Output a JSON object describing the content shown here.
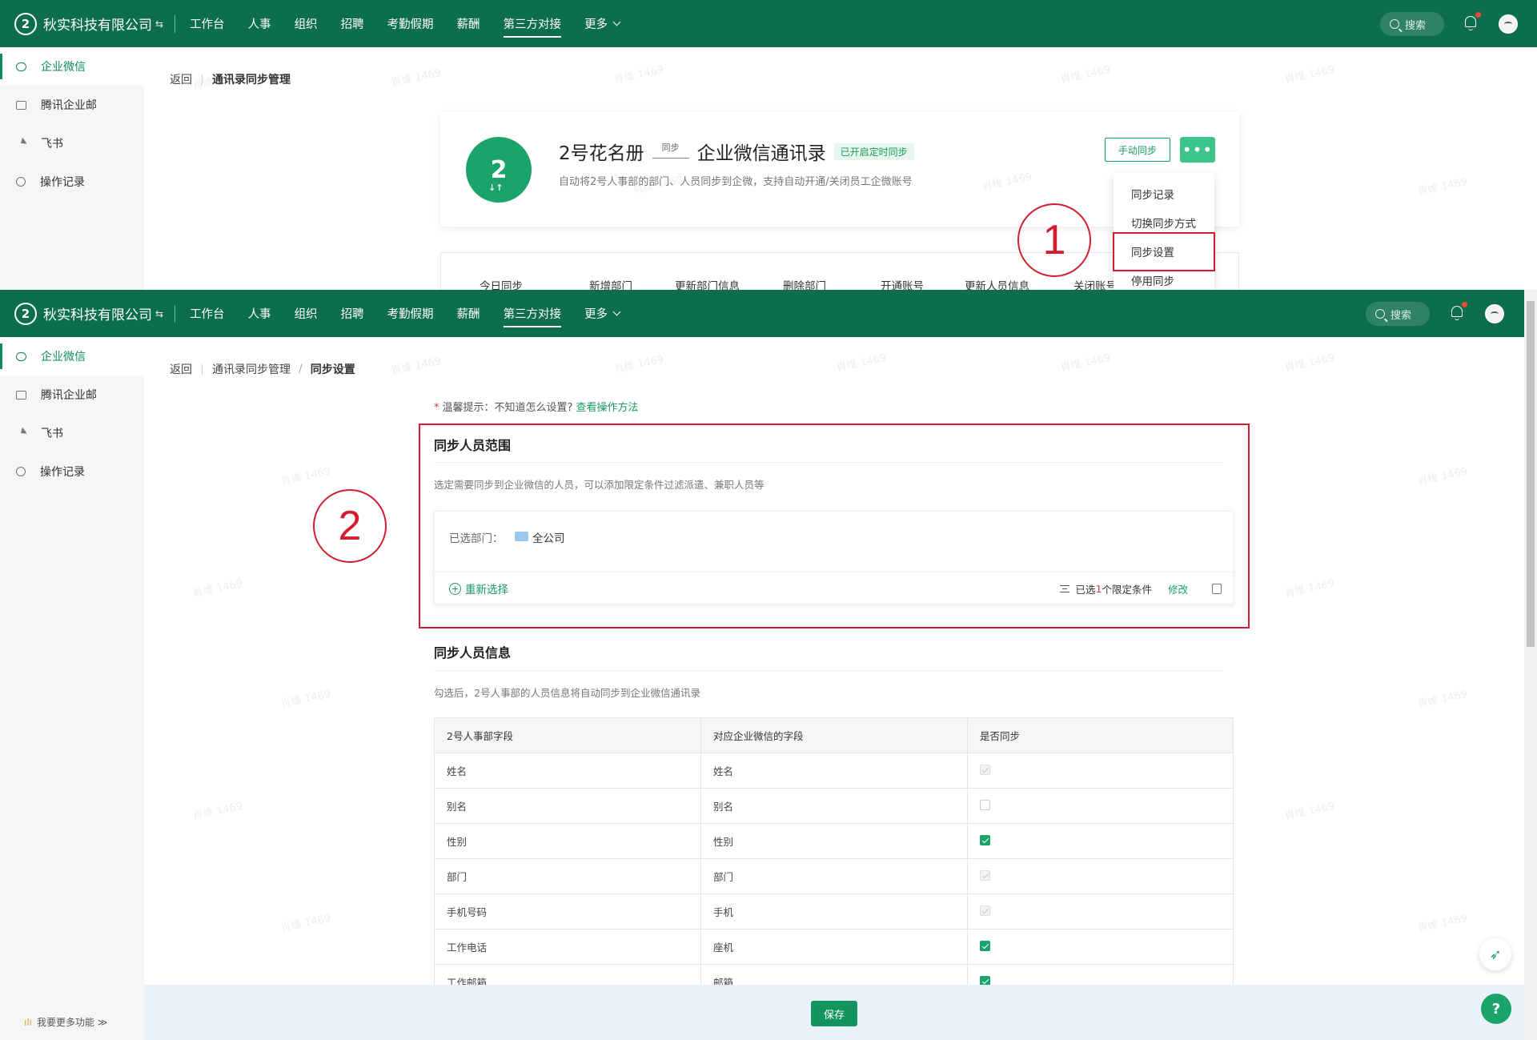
{
  "header": {
    "logo_mark": "2",
    "company": "秋实科技有限公司",
    "switch_icon": "⇆",
    "nav": [
      "工作台",
      "人事",
      "组织",
      "招聘",
      "考勤假期",
      "薪酬",
      "第三方对接",
      "更多"
    ],
    "active_nav": "第三方对接",
    "search_placeholder": "搜索"
  },
  "sidebar": {
    "items": [
      {
        "label": "企业微信",
        "icon": "chat-icon",
        "active": true
      },
      {
        "label": "腾讯企业邮",
        "icon": "mail-icon"
      },
      {
        "label": "飞书",
        "icon": "send-icon"
      },
      {
        "label": "操作记录",
        "icon": "clock-icon"
      }
    ],
    "more_features": "我要更多功能",
    "more_features_arrow": "≫"
  },
  "pane1": {
    "breadcrumb": {
      "back": "返回",
      "page": "通讯录同步管理"
    },
    "card": {
      "logo_text": "2",
      "logo_arrows": "↓↑",
      "source": "2号花名册",
      "sync_label": "同步",
      "target": "企业微信通讯录",
      "tag": "已开启定时同步",
      "desc": "自动将2号人事部的部门、人员同步到企微，支持自动开通/关闭员工企微账号",
      "manual_sync": "手动同步",
      "more_dots": "•••"
    },
    "dropdown": [
      "同步记录",
      "切换同步方式",
      "同步设置",
      "停用同步"
    ],
    "annotation": "1",
    "stats": [
      "今日同步",
      "新增部门",
      "更新部门信息",
      "删除部门",
      "开通账号",
      "更新人员信息",
      "关闭账号"
    ]
  },
  "pane2": {
    "breadcrumb": {
      "back": "返回",
      "parent": "通讯录同步管理",
      "current": "同步设置"
    },
    "hint": {
      "star": "*",
      "text": "温馨提示：不知道怎么设置?",
      "link": "查看操作方法"
    },
    "annotation": "2",
    "scope": {
      "title": "同步人员范围",
      "desc": "选定需要同步到企业微信的人员，可以添加限定条件过滤派遣、兼职人员等",
      "selected_label": "已选部门：",
      "selected_value": "全公司",
      "reselect": "重新选择",
      "condition_prefix": "已选",
      "condition_count": "1",
      "condition_suffix": "个限定条件",
      "edit": "修改"
    },
    "info": {
      "title": "同步人员信息",
      "desc": "勾选后，2号人事部的人员信息将自动同步到企业微信通讯录",
      "columns": [
        "2号人事部字段",
        "对应企业微信的字段",
        "是否同步"
      ],
      "rows": [
        {
          "source": "姓名",
          "target": "姓名",
          "sync": "disabled-checked"
        },
        {
          "source": "别名",
          "target": "别名",
          "sync": "unchecked"
        },
        {
          "source": "性别",
          "target": "性别",
          "sync": "checked"
        },
        {
          "source": "部门",
          "target": "部门",
          "sync": "disabled-checked"
        },
        {
          "source": "手机号码",
          "target": "手机",
          "sync": "disabled-checked"
        },
        {
          "source": "工作电话",
          "target": "座机",
          "sync": "checked"
        },
        {
          "source": "工作邮箱",
          "target": "邮箱",
          "sync": "checked"
        }
      ]
    },
    "save": "保存",
    "fab_leaf": "➶",
    "fab_help": "?"
  },
  "watermark": "肖维 1469",
  "colors": {
    "brand": "#0d6e4b",
    "accent": "#1aa36a",
    "annotation": "#d41c2e"
  }
}
